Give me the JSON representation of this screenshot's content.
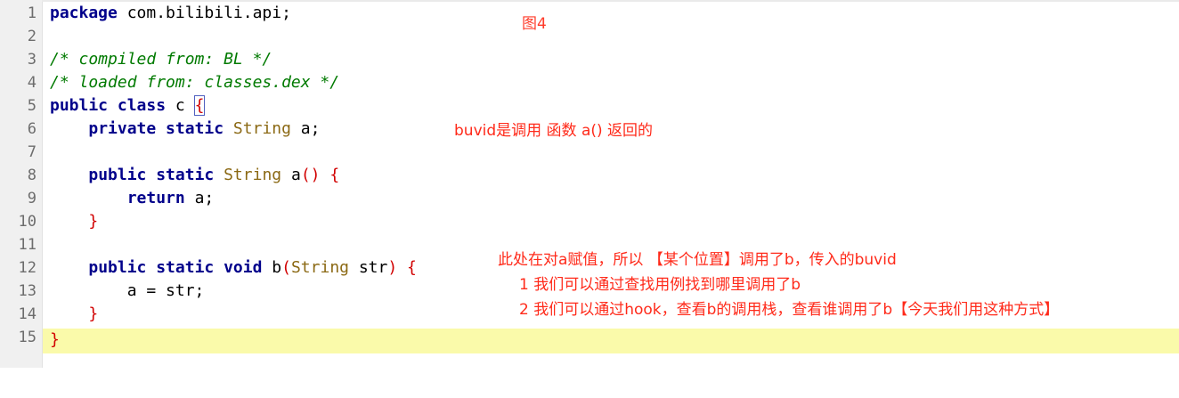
{
  "editor": {
    "lines": [
      {
        "n": "1"
      },
      {
        "n": "2"
      },
      {
        "n": "3"
      },
      {
        "n": "4"
      },
      {
        "n": "5"
      },
      {
        "n": "6"
      },
      {
        "n": "7"
      },
      {
        "n": "8"
      },
      {
        "n": "9"
      },
      {
        "n": "10"
      },
      {
        "n": "11"
      },
      {
        "n": "12"
      },
      {
        "n": "13"
      },
      {
        "n": "14"
      },
      {
        "n": "15"
      }
    ],
    "current_line": "15",
    "colors": {
      "keyword": "#00008b",
      "type": "#8b6914",
      "comment": "#007a00",
      "brace": "#d10000",
      "current_line_bg": "#fafaaa",
      "annotation": "#ff2a1a"
    },
    "code": {
      "l1_kw": "package",
      "l1_rest": " com.bilibili.api;",
      "l3_comment": "/* compiled from: BL */",
      "l4_comment": "/* loaded from: classes.dex */",
      "l5_kw": "public class",
      "l5_name": " c ",
      "l5_brace": "{",
      "l6_kw": "private static",
      "l6_type": "String",
      "l6_rest": " a;",
      "l8_kw": "public static",
      "l8_type": "String",
      "l8_name": " a",
      "l8_paren": "()",
      "l8_brace": "{",
      "l9_kw": "return",
      "l9_rest": " a;",
      "l10_brace": "}",
      "l12_kw": "public static void",
      "l12_name": " b",
      "l12_paren_open": "(",
      "l12_type": "String",
      "l12_param": " str",
      "l12_paren_close": ")",
      "l12_brace": "{",
      "l13_rest": "a = str;",
      "l14_brace": "}",
      "l15_brace": "}"
    }
  },
  "annotations": {
    "figure_label": "图4",
    "buvid_note": "buvid是调用 函数 a() 返回的",
    "assign_note": "此处在对a赋值，所以 【某个位置】调用了b，传入的buvid",
    "step1": "1 我们可以通过查找用例找到哪里调用了b",
    "step2": "2 我们可以通过hook，查看b的调用栈，查看谁调用了b【今天我们用这种方式】"
  }
}
